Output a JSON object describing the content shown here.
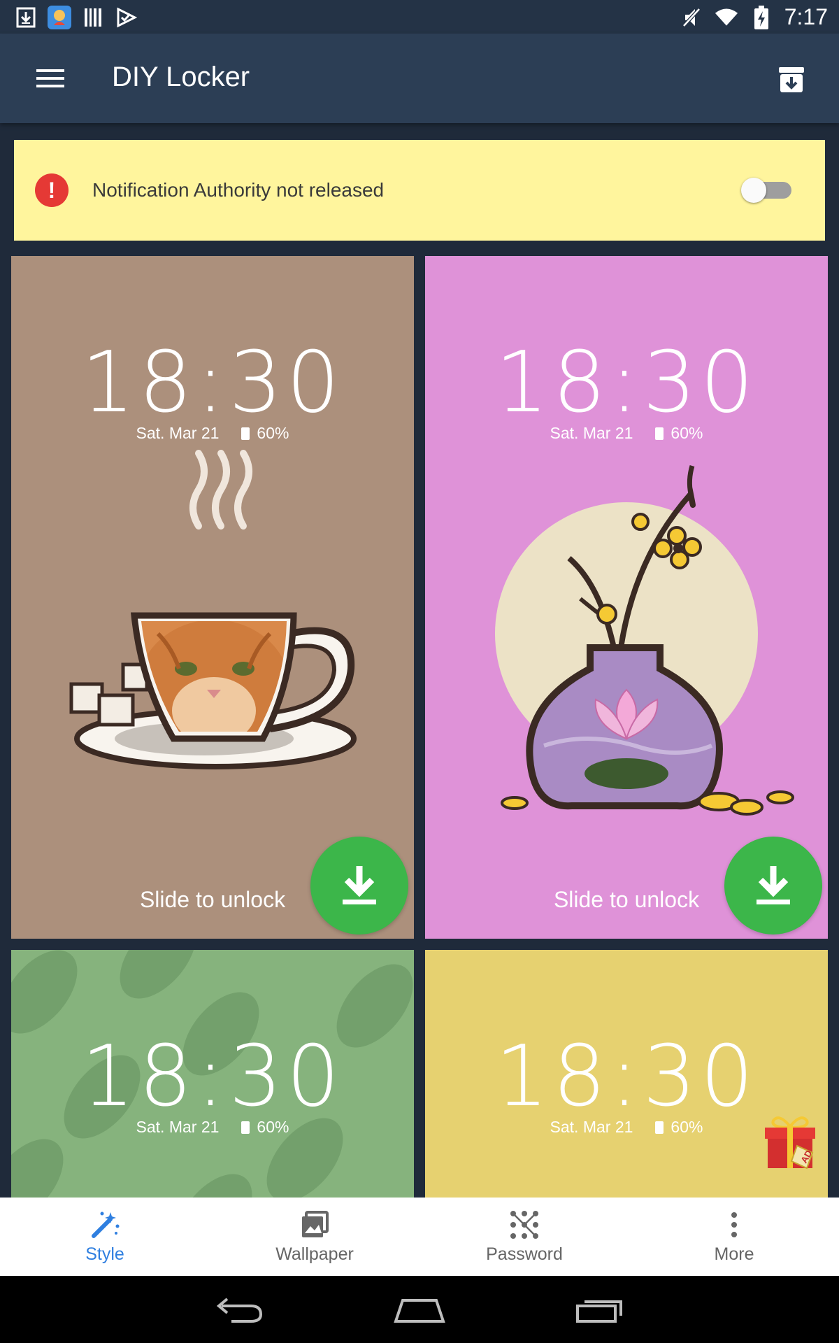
{
  "status_bar": {
    "time": "7:17",
    "icons_left": [
      "download-icon",
      "app-icon",
      "barcode-icon",
      "play-check-icon"
    ],
    "icons_right": [
      "mute-icon",
      "wifi-icon",
      "battery-charging-icon"
    ]
  },
  "app_bar": {
    "title": "DIY Locker",
    "menu_icon": "menu-icon",
    "action_icon": "archive-download-icon"
  },
  "notice": {
    "text": "Notification Authority not released",
    "icon": "alert-icon",
    "toggle_on": false
  },
  "cards": [
    {
      "time": "18:30",
      "date": "Sat. Mar 21",
      "battery": "60%",
      "slide": "Slide to unlock",
      "bg": "#ac907c",
      "art": "cat-in-teacup"
    },
    {
      "time": "18:30",
      "date": "Sat. Mar 21",
      "battery": "60%",
      "slide": "Slide to unlock",
      "bg": "#df92d8",
      "art": "lotus-vase"
    },
    {
      "time": "18:30",
      "date": "Sat. Mar 21",
      "battery": "60%",
      "bg": "#86b37d",
      "art": "leaf-pattern"
    },
    {
      "time": "18:30",
      "date": "Sat. Mar 21",
      "battery": "60%",
      "bg": "#e6d170",
      "art": "gift-ad",
      "ad_label": "AD"
    }
  ],
  "bottom_nav": {
    "items": [
      {
        "label": "Style",
        "icon": "magic-wand-icon",
        "active": true
      },
      {
        "label": "Wallpaper",
        "icon": "image-icon",
        "active": false
      },
      {
        "label": "Password",
        "icon": "pattern-icon",
        "active": false
      },
      {
        "label": "More",
        "icon": "more-vert-icon",
        "active": false
      }
    ]
  },
  "colors": {
    "status_bar": "#243346",
    "app_bar": "#2c3e55",
    "notice_bg": "#fff59d",
    "alert": "#e53935",
    "download_green": "#3cb64a",
    "active_nav": "#2f7fe0"
  }
}
